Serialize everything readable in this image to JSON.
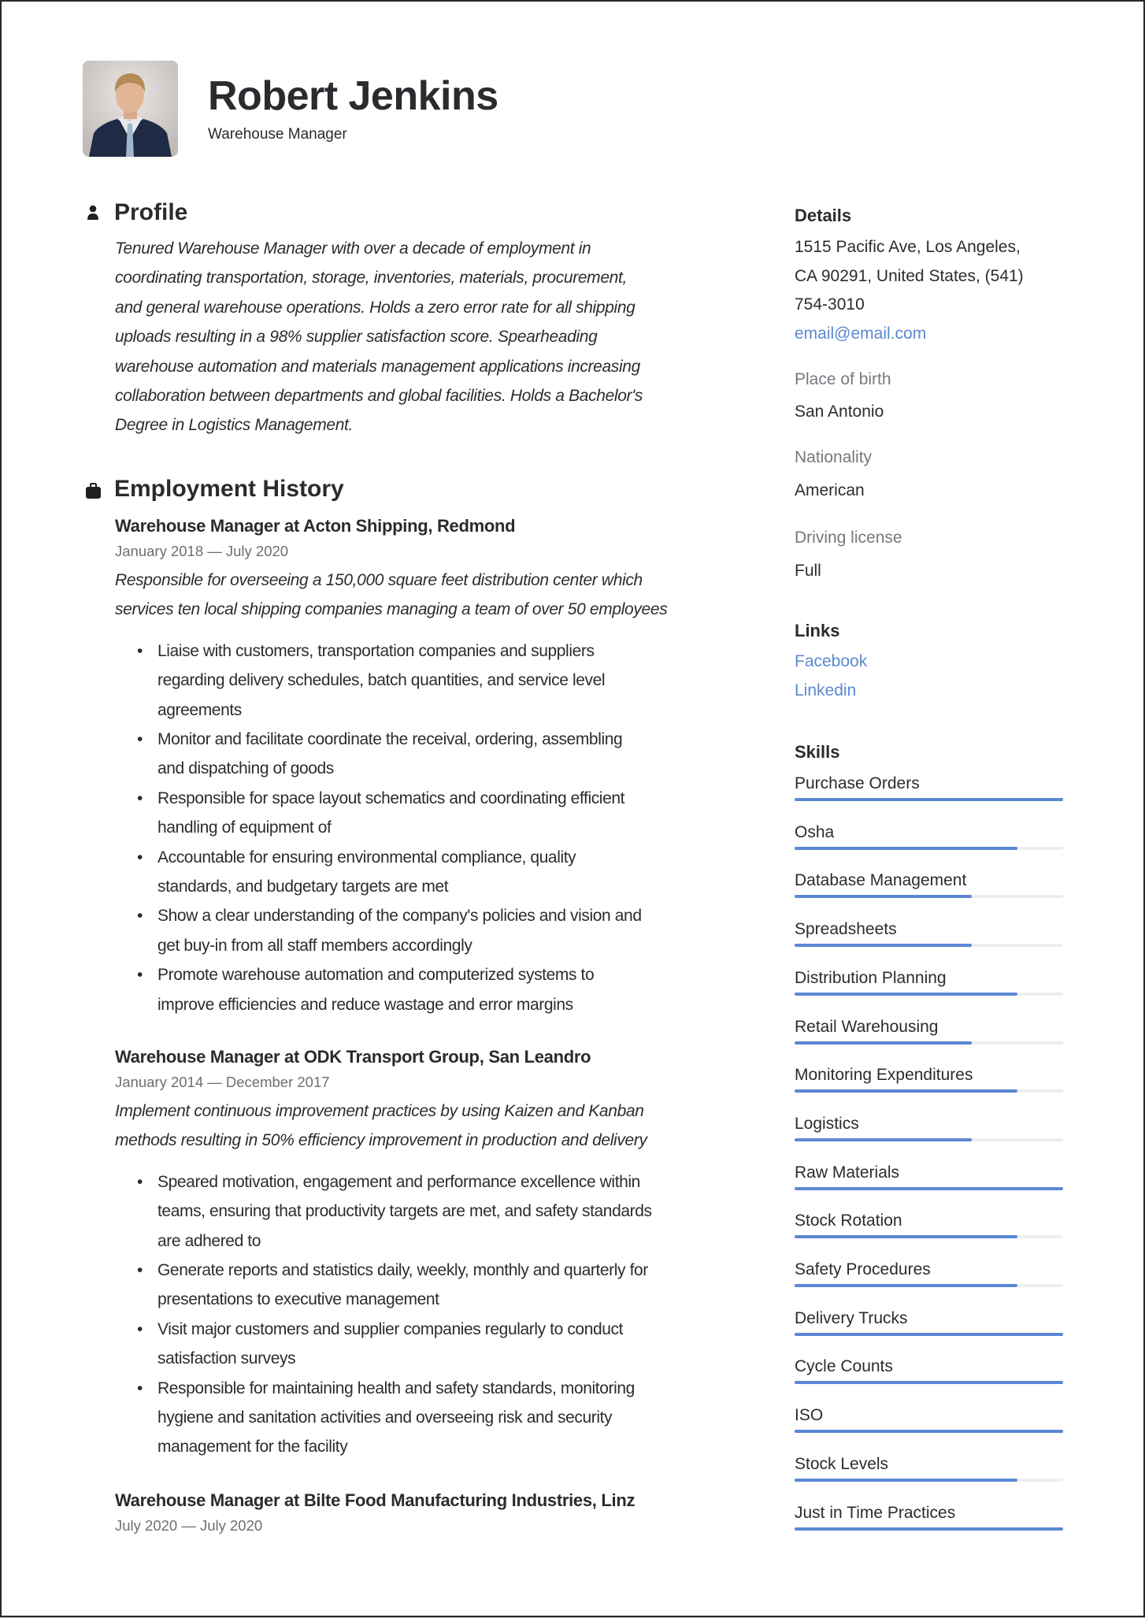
{
  "header": {
    "name": "Robert Jenkins",
    "title": "Warehouse Manager",
    "photo_alt": "portrait-photo"
  },
  "profile": {
    "heading": "Profile",
    "icon": "person-icon",
    "lines": [
      "Tenured Warehouse Manager with over a decade of employment in",
      "coordinating transportation, storage, inventories, materials, procurement,",
      "and general warehouse operations. Holds a zero error rate for all shipping",
      "uploads resulting in a 98% supplier satisfaction score. Spearheading",
      "warehouse automation and materials management applications increasing",
      "collaboration between departments and global facilities. Holds a Bachelor's",
      "Degree in Logistics Management."
    ]
  },
  "employment": {
    "heading": "Employment History",
    "icon": "briefcase-icon",
    "jobs": [
      {
        "title": "Warehouse Manager at Acton Shipping, Redmond",
        "dates": "January 2018 — July 2020",
        "summary": [
          "Responsible for overseeing a 150,000 square feet distribution center which",
          "services ten local shipping companies managing a team of over 50 employees"
        ],
        "bullets": [
          [
            "Liaise with customers, transportation companies and suppliers",
            "regarding delivery schedules, batch quantities, and service level",
            "agreements"
          ],
          [
            "Monitor and facilitate coordinate the receival, ordering, assembling",
            "and dispatching of goods"
          ],
          [
            "Responsible for space layout schematics and coordinating efficient",
            "handling of equipment of"
          ],
          [
            "Accountable for ensuring environmental compliance, quality",
            "standards, and budgetary targets are met"
          ],
          [
            "Show a clear understanding of the company's policies and vision and",
            "get buy-in from all staff members accordingly"
          ],
          [
            "Promote warehouse automation and computerized systems to",
            "improve efficiencies and reduce wastage and error margins"
          ]
        ]
      },
      {
        "title": "Warehouse Manager at ODK Transport Group, San Leandro",
        "dates": "January 2014 — December 2017",
        "summary": [
          "Implement continuous improvement practices by using Kaizen and Kanban",
          "methods resulting in 50% efficiency improvement in production and delivery"
        ],
        "bullets": [
          [
            "Speared motivation, engagement and performance excellence within",
            "teams, ensuring that productivity targets are met, and safety standards",
            "are adhered to"
          ],
          [
            "Generate reports and statistics daily, weekly, monthly and quarterly for",
            "presentations to executive management"
          ],
          [
            "Visit major customers and supplier companies regularly to conduct",
            "satisfaction surveys"
          ],
          [
            "Responsible for maintaining health and safety standards, monitoring",
            "hygiene and sanitation activities and overseeing risk and security",
            "management for the facility"
          ]
        ]
      },
      {
        "title": "Warehouse Manager at Bilte Food Manufacturing Industries, Linz",
        "dates": "July 2020 — July 2020",
        "summary": [],
        "bullets": []
      }
    ]
  },
  "details": {
    "heading": "Details",
    "address_lines": [
      "1515 Pacific Ave, Los Angeles,",
      "CA 90291, United States, (541)",
      "754-3010"
    ],
    "email": "email@email.com",
    "place_of_birth_label": "Place of birth",
    "place_of_birth": "San Antonio",
    "nationality_label": "Nationality",
    "nationality": "American",
    "driving_license_label": "Driving license",
    "driving_license": "Full"
  },
  "links": {
    "heading": "Links",
    "items": [
      "Facebook",
      "Linkedin"
    ]
  },
  "skills": {
    "heading": "Skills",
    "items": [
      {
        "name": "Purchase Orders",
        "level": 1.0
      },
      {
        "name": "Osha",
        "level": 0.83
      },
      {
        "name": "Database Management",
        "level": 0.66
      },
      {
        "name": "Spreadsheets",
        "level": 0.66
      },
      {
        "name": "Distribution Planning",
        "level": 0.83
      },
      {
        "name": "Retail Warehousing",
        "level": 0.66
      },
      {
        "name": "Monitoring Expenditures",
        "level": 0.83
      },
      {
        "name": "Logistics",
        "level": 0.66
      },
      {
        "name": "Raw Materials",
        "level": 1.0
      },
      {
        "name": "Stock Rotation",
        "level": 0.83
      },
      {
        "name": "Safety Procedures",
        "level": 0.83
      },
      {
        "name": "Delivery Trucks",
        "level": 1.0
      },
      {
        "name": "Cycle Counts",
        "level": 1.0
      },
      {
        "name": "ISO",
        "level": 1.0
      },
      {
        "name": "Stock Levels",
        "level": 0.83
      },
      {
        "name": "Just in Time Practices",
        "level": 1.0
      }
    ]
  },
  "colors": {
    "accent": "#5b87d4",
    "link": "#5b89cf",
    "track": "#eceef2",
    "text": "#2b2c30",
    "muted": "#6c6f74"
  }
}
